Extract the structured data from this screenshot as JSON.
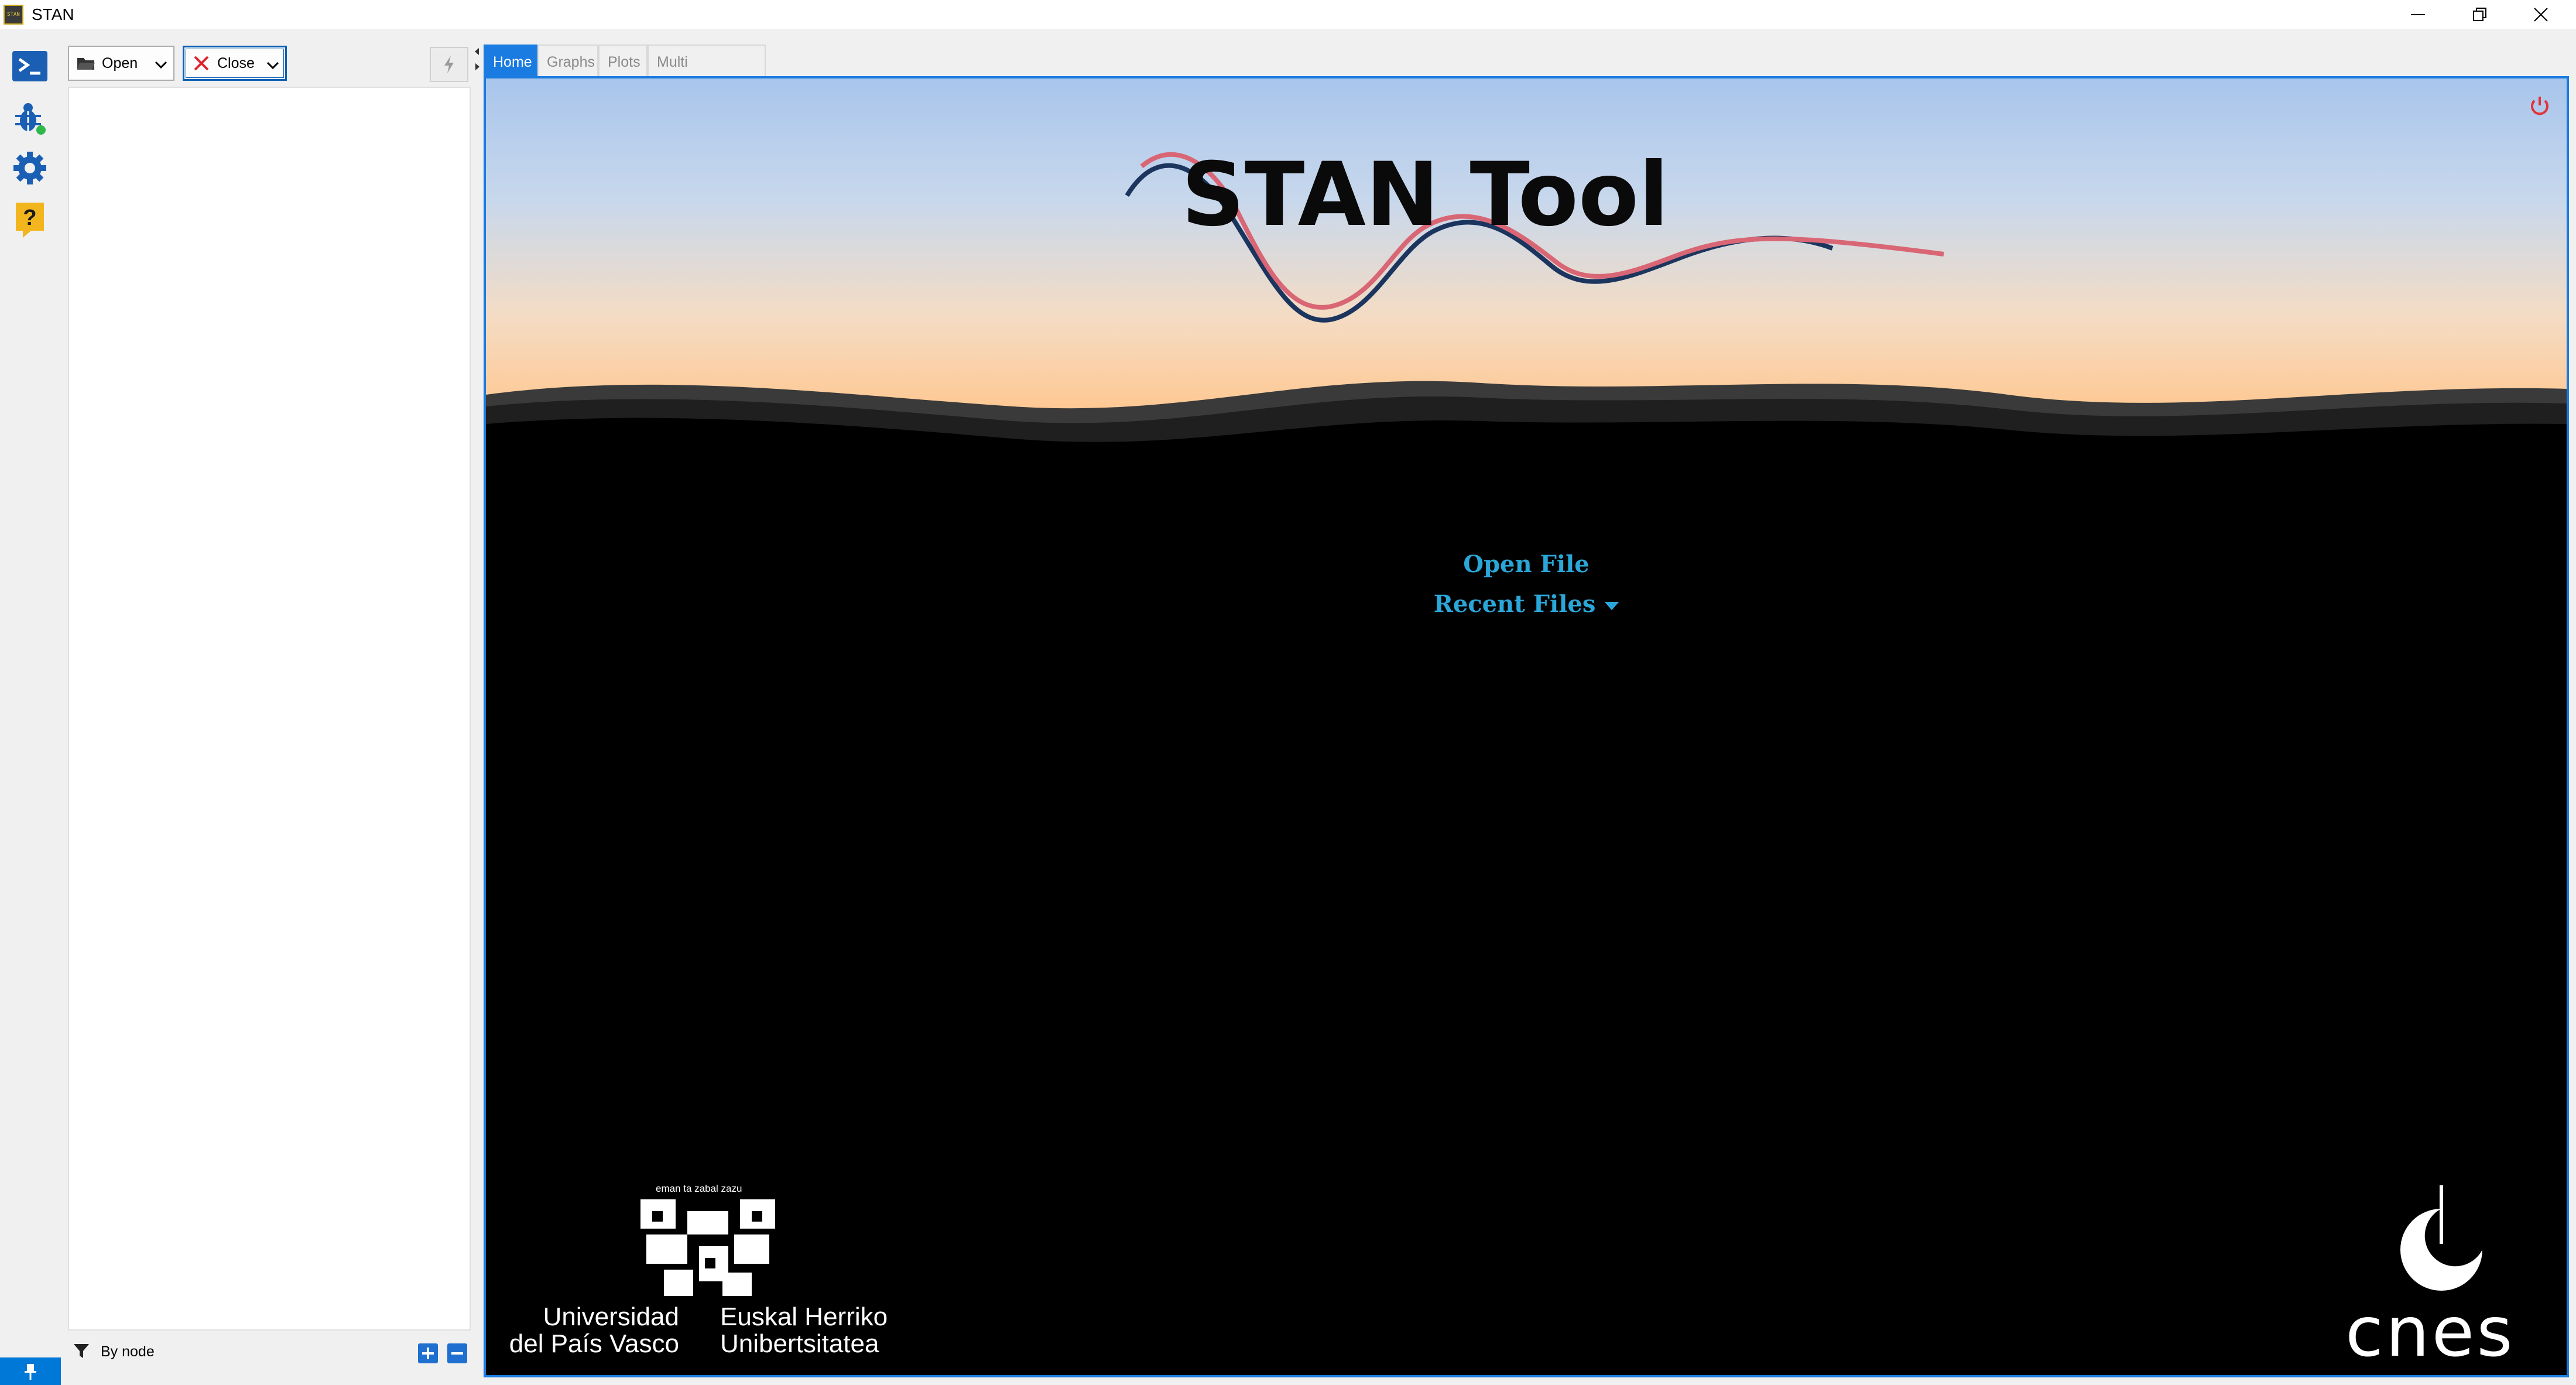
{
  "window": {
    "title": "STAN",
    "app_icon_text": "STAN"
  },
  "toolbar": {
    "open_label": "Open",
    "close_label": "Close"
  },
  "tree_footer": {
    "filter_label": "By node"
  },
  "tabs": [
    {
      "label": "Home",
      "active": true
    },
    {
      "label": "Graphs",
      "active": false
    },
    {
      "label": "Plots",
      "active": false
    },
    {
      "label": "Multi Parameters",
      "active": false
    }
  ],
  "home": {
    "logo_title": "STAN Tool",
    "open_file_link": "Open File",
    "recent_files_link": "Recent Files"
  },
  "partners": {
    "ehu_motto": "eman ta zabal zazu",
    "ehu_name_es_line1": "Universidad",
    "ehu_name_es_line2": "del País Vasco",
    "ehu_name_eu_line1": "Euskal Herriko",
    "ehu_name_eu_line2": "Unibertsitatea",
    "cnes_name": "cnes"
  },
  "icons": {
    "activity": [
      "terminal-icon",
      "bug-icon",
      "gear-icon",
      "help-icon"
    ],
    "power": "power-icon"
  },
  "colors": {
    "accent": "#1a7be0",
    "link": "#2aa6d8",
    "power": "#e0343a",
    "wave_red": "#d96674",
    "wave_navy": "#1b355e"
  }
}
